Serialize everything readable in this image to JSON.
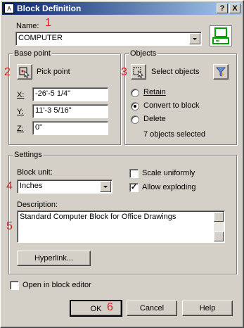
{
  "window": {
    "title": "Block Definition",
    "help_btn": "?",
    "close_btn": "X"
  },
  "name": {
    "label": "Name:",
    "value": "COMPUTER"
  },
  "base_point": {
    "group_label": "Base point",
    "pick_label": "Pick point",
    "x_label": "X:",
    "y_label": "Y:",
    "z_label": "Z:",
    "x_value": "-26'-5 1/4\"",
    "y_value": "11'-3 5/16\"",
    "z_value": "0\""
  },
  "objects": {
    "group_label": "Objects",
    "select_label": "Select objects",
    "options": [
      {
        "label": "Retain",
        "selected": false
      },
      {
        "label": "Convert to block",
        "selected": true
      },
      {
        "label": "Delete",
        "selected": false
      }
    ],
    "status": "7 objects selected"
  },
  "settings": {
    "group_label": "Settings",
    "unit_label": "Block unit:",
    "unit_value": "Inches",
    "scale_uniformly": "Scale uniformly",
    "scale_uniformly_checked": false,
    "allow_exploding": "Allow exploding",
    "allow_exploding_checked": true,
    "description_label": "Description:",
    "description_value": "Standard Computer Block for Office Drawings",
    "hyperlink_label": "Hyperlink..."
  },
  "open_in_editor": {
    "label": "Open in block editor",
    "checked": false
  },
  "footer": {
    "ok": "OK",
    "cancel": "Cancel",
    "help": "Help"
  },
  "callouts": [
    "1",
    "2",
    "3",
    "4",
    "5",
    "6"
  ],
  "icons": [
    "dialog-app-icon",
    "block-preview-icon",
    "pick-point-icon",
    "select-objects-icon",
    "quick-select-icon"
  ],
  "colors": {
    "title_gradient_start": "#0a246a",
    "title_gradient_end": "#a6caf0",
    "callout_red": "#d42020",
    "preview_green": "#00a000"
  }
}
